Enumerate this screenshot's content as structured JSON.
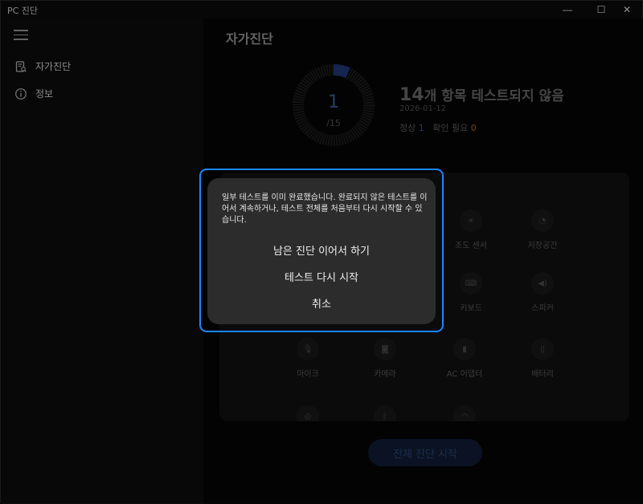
{
  "window": {
    "title": "PC 진단",
    "controls": {
      "minimize": "—",
      "maximize": "☐",
      "close": "✕"
    }
  },
  "sidebar": {
    "items": [
      {
        "label": "자가진단",
        "icon": "diagnostic-icon"
      },
      {
        "label": "정보",
        "icon": "info-icon"
      }
    ]
  },
  "main": {
    "title": "자가진단",
    "progress": {
      "done": "1",
      "total": "/15",
      "fraction": 0.0667
    },
    "summary": {
      "count": "14",
      "text": "개 항목 테스트되지 않음",
      "date": "2026-01-12",
      "normal_label": "정상",
      "normal_value": "1",
      "check_label": "확인 필요",
      "check_value": "0"
    },
    "tests": [
      {
        "label": "조도 센서",
        "icon": "light-sensor-icon"
      },
      {
        "label": "저장공간",
        "icon": "storage-icon"
      },
      {
        "label": "키보드",
        "icon": "keyboard-icon"
      },
      {
        "label": "스피커",
        "icon": "speaker-icon"
      },
      {
        "label": "마이크",
        "icon": "microphone-icon"
      },
      {
        "label": "카메라",
        "icon": "camera-icon"
      },
      {
        "label": "AC 어댑터",
        "icon": "ac-adapter-icon"
      },
      {
        "label": "배터리",
        "icon": "battery-icon"
      }
    ],
    "start_button": "전체 진단 시작"
  },
  "dialog": {
    "message": "일부 테스트를 이미 완료했습니다. 완료되지 않은 테스트를 이어서 계속하거나, 테스트 전체를 처음부터 다시 시작할 수 있습니다.",
    "continue": "남은 진단 이어서 하기",
    "restart": "테스트 다시 시작",
    "cancel": "취소"
  },
  "colors": {
    "accent": "#1e86ff",
    "ok": "#2f57b0",
    "check": "#b06a2a",
    "dialog_bg": "#2c2c2c"
  }
}
